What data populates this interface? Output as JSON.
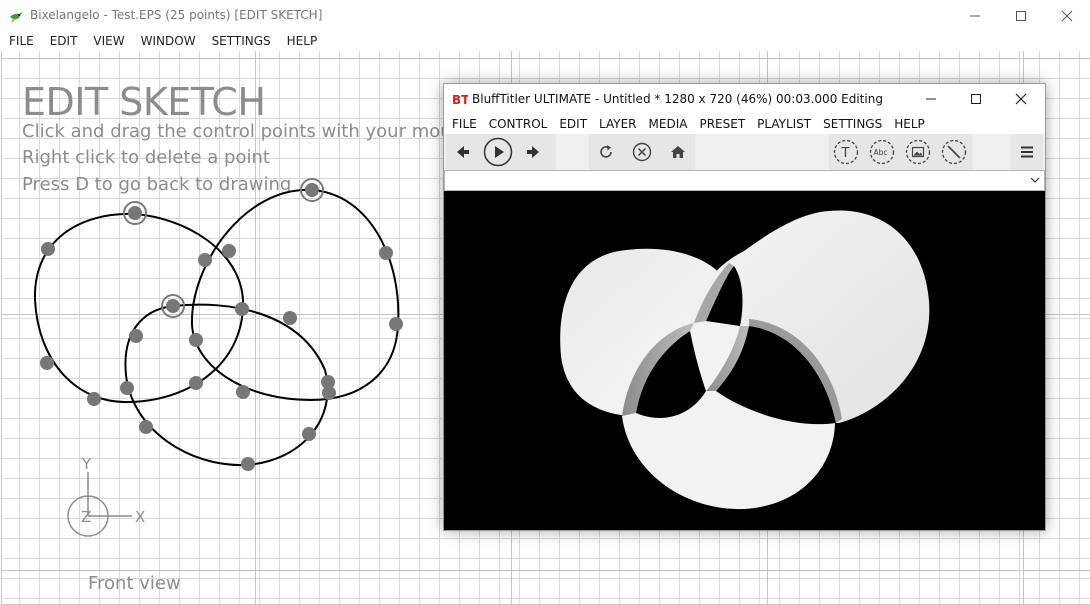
{
  "main_window": {
    "title": "Bixelangelo - Test.EPS (25 points) [EDIT SKETCH]",
    "menu": [
      "FILE",
      "EDIT",
      "VIEW",
      "WINDOW",
      "SETTINGS",
      "HELP"
    ],
    "mode_title": "EDIT SKETCH",
    "hints": [
      "Click and drag the control points with your mouse",
      "Right click to delete a point",
      "Press D to go back to drawing"
    ],
    "view_label": "Front view",
    "axes": {
      "y": "Y",
      "z": "Z",
      "x": "X"
    }
  },
  "blufftitler": {
    "logo": "BT",
    "title": "BluffTitler ULTIMATE  - Untitled * 1280 x 720 (46%) 00:03.000 Editing",
    "menu": [
      "FILE",
      "CONTROL",
      "EDIT",
      "LAYER",
      "MEDIA",
      "PRESET",
      "PLAYLIST",
      "SETTINGS",
      "HELP"
    ],
    "toolbar": {
      "text_layer_glyph": "T",
      "abc_layer_glyph": "Abc"
    }
  },
  "icons": {
    "app": "hummingbird-icon",
    "minimize": "minimize-icon",
    "maximize": "maximize-icon",
    "close": "close-icon",
    "back": "arrow-left-icon",
    "play": "play-icon",
    "forward": "arrow-right-icon",
    "refresh": "refresh-icon",
    "cancel": "cancel-icon",
    "home": "home-icon",
    "text_layer": "text-layer-icon",
    "abc_layer": "abc-layer-icon",
    "picture_layer": "picture-layer-icon",
    "no_layer": "no-layer-icon",
    "hamburger": "hamburger-menu-icon",
    "dropdown": "chevron-down-icon"
  },
  "colors": {
    "grid_line": "#d9d9d9",
    "text_gray": "#8c8c8c",
    "point_fill": "#777777",
    "curve": "#000000",
    "preview_bg": "#000000",
    "bt_logo_red": "#e0201b"
  }
}
